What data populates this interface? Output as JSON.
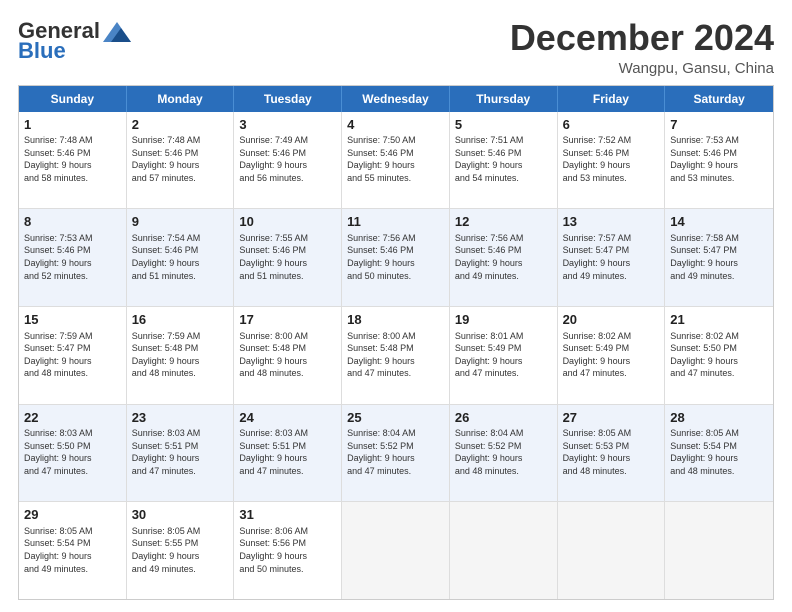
{
  "header": {
    "logo_general": "General",
    "logo_blue": "Blue",
    "month_title": "December 2024",
    "location": "Wangpu, Gansu, China"
  },
  "weekdays": [
    "Sunday",
    "Monday",
    "Tuesday",
    "Wednesday",
    "Thursday",
    "Friday",
    "Saturday"
  ],
  "rows": [
    [
      {
        "day": "1",
        "lines": [
          "Sunrise: 7:48 AM",
          "Sunset: 5:46 PM",
          "Daylight: 9 hours",
          "and 58 minutes."
        ]
      },
      {
        "day": "2",
        "lines": [
          "Sunrise: 7:48 AM",
          "Sunset: 5:46 PM",
          "Daylight: 9 hours",
          "and 57 minutes."
        ]
      },
      {
        "day": "3",
        "lines": [
          "Sunrise: 7:49 AM",
          "Sunset: 5:46 PM",
          "Daylight: 9 hours",
          "and 56 minutes."
        ]
      },
      {
        "day": "4",
        "lines": [
          "Sunrise: 7:50 AM",
          "Sunset: 5:46 PM",
          "Daylight: 9 hours",
          "and 55 minutes."
        ]
      },
      {
        "day": "5",
        "lines": [
          "Sunrise: 7:51 AM",
          "Sunset: 5:46 PM",
          "Daylight: 9 hours",
          "and 54 minutes."
        ]
      },
      {
        "day": "6",
        "lines": [
          "Sunrise: 7:52 AM",
          "Sunset: 5:46 PM",
          "Daylight: 9 hours",
          "and 53 minutes."
        ]
      },
      {
        "day": "7",
        "lines": [
          "Sunrise: 7:53 AM",
          "Sunset: 5:46 PM",
          "Daylight: 9 hours",
          "and 53 minutes."
        ]
      }
    ],
    [
      {
        "day": "8",
        "lines": [
          "Sunrise: 7:53 AM",
          "Sunset: 5:46 PM",
          "Daylight: 9 hours",
          "and 52 minutes."
        ]
      },
      {
        "day": "9",
        "lines": [
          "Sunrise: 7:54 AM",
          "Sunset: 5:46 PM",
          "Daylight: 9 hours",
          "and 51 minutes."
        ]
      },
      {
        "day": "10",
        "lines": [
          "Sunrise: 7:55 AM",
          "Sunset: 5:46 PM",
          "Daylight: 9 hours",
          "and 51 minutes."
        ]
      },
      {
        "day": "11",
        "lines": [
          "Sunrise: 7:56 AM",
          "Sunset: 5:46 PM",
          "Daylight: 9 hours",
          "and 50 minutes."
        ]
      },
      {
        "day": "12",
        "lines": [
          "Sunrise: 7:56 AM",
          "Sunset: 5:46 PM",
          "Daylight: 9 hours",
          "and 49 minutes."
        ]
      },
      {
        "day": "13",
        "lines": [
          "Sunrise: 7:57 AM",
          "Sunset: 5:47 PM",
          "Daylight: 9 hours",
          "and 49 minutes."
        ]
      },
      {
        "day": "14",
        "lines": [
          "Sunrise: 7:58 AM",
          "Sunset: 5:47 PM",
          "Daylight: 9 hours",
          "and 49 minutes."
        ]
      }
    ],
    [
      {
        "day": "15",
        "lines": [
          "Sunrise: 7:59 AM",
          "Sunset: 5:47 PM",
          "Daylight: 9 hours",
          "and 48 minutes."
        ]
      },
      {
        "day": "16",
        "lines": [
          "Sunrise: 7:59 AM",
          "Sunset: 5:48 PM",
          "Daylight: 9 hours",
          "and 48 minutes."
        ]
      },
      {
        "day": "17",
        "lines": [
          "Sunrise: 8:00 AM",
          "Sunset: 5:48 PM",
          "Daylight: 9 hours",
          "and 48 minutes."
        ]
      },
      {
        "day": "18",
        "lines": [
          "Sunrise: 8:00 AM",
          "Sunset: 5:48 PM",
          "Daylight: 9 hours",
          "and 47 minutes."
        ]
      },
      {
        "day": "19",
        "lines": [
          "Sunrise: 8:01 AM",
          "Sunset: 5:49 PM",
          "Daylight: 9 hours",
          "and 47 minutes."
        ]
      },
      {
        "day": "20",
        "lines": [
          "Sunrise: 8:02 AM",
          "Sunset: 5:49 PM",
          "Daylight: 9 hours",
          "and 47 minutes."
        ]
      },
      {
        "day": "21",
        "lines": [
          "Sunrise: 8:02 AM",
          "Sunset: 5:50 PM",
          "Daylight: 9 hours",
          "and 47 minutes."
        ]
      }
    ],
    [
      {
        "day": "22",
        "lines": [
          "Sunrise: 8:03 AM",
          "Sunset: 5:50 PM",
          "Daylight: 9 hours",
          "and 47 minutes."
        ]
      },
      {
        "day": "23",
        "lines": [
          "Sunrise: 8:03 AM",
          "Sunset: 5:51 PM",
          "Daylight: 9 hours",
          "and 47 minutes."
        ]
      },
      {
        "day": "24",
        "lines": [
          "Sunrise: 8:03 AM",
          "Sunset: 5:51 PM",
          "Daylight: 9 hours",
          "and 47 minutes."
        ]
      },
      {
        "day": "25",
        "lines": [
          "Sunrise: 8:04 AM",
          "Sunset: 5:52 PM",
          "Daylight: 9 hours",
          "and 47 minutes."
        ]
      },
      {
        "day": "26",
        "lines": [
          "Sunrise: 8:04 AM",
          "Sunset: 5:52 PM",
          "Daylight: 9 hours",
          "and 48 minutes."
        ]
      },
      {
        "day": "27",
        "lines": [
          "Sunrise: 8:05 AM",
          "Sunset: 5:53 PM",
          "Daylight: 9 hours",
          "and 48 minutes."
        ]
      },
      {
        "day": "28",
        "lines": [
          "Sunrise: 8:05 AM",
          "Sunset: 5:54 PM",
          "Daylight: 9 hours",
          "and 48 minutes."
        ]
      }
    ],
    [
      {
        "day": "29",
        "lines": [
          "Sunrise: 8:05 AM",
          "Sunset: 5:54 PM",
          "Daylight: 9 hours",
          "and 49 minutes."
        ]
      },
      {
        "day": "30",
        "lines": [
          "Sunrise: 8:05 AM",
          "Sunset: 5:55 PM",
          "Daylight: 9 hours",
          "and 49 minutes."
        ]
      },
      {
        "day": "31",
        "lines": [
          "Sunrise: 8:06 AM",
          "Sunset: 5:56 PM",
          "Daylight: 9 hours",
          "and 50 minutes."
        ]
      },
      {
        "day": "",
        "lines": []
      },
      {
        "day": "",
        "lines": []
      },
      {
        "day": "",
        "lines": []
      },
      {
        "day": "",
        "lines": []
      }
    ]
  ]
}
